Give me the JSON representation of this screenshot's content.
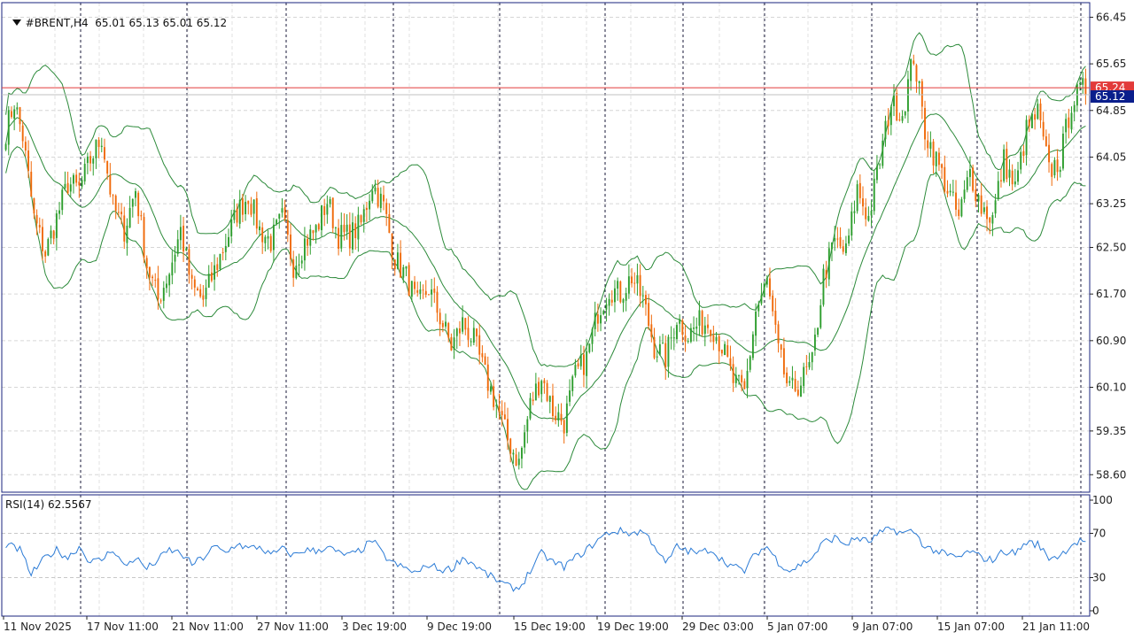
{
  "header": {
    "symbol_timeframe": "#BRENT,H4",
    "ohlc": "65.01 65.13 65.01 65.12",
    "menu_icon": "triangle-down-icon"
  },
  "price_panel": {
    "price_ticks": [
      "66.45",
      "65.65",
      "64.85",
      "64.05",
      "63.25",
      "62.50",
      "61.70",
      "60.90",
      "60.10",
      "59.35",
      "58.60"
    ],
    "bid_line_label": "65.24",
    "last_price_label": "65.12",
    "colors": {
      "bull": "#2e9e2e",
      "bear": "#f06a0a",
      "bands": "#2c8a3a",
      "bid_line": "#e23a3a",
      "last_price_bg": "#0a1e8c"
    }
  },
  "rsi_panel": {
    "label": "RSI(14) 62.5567",
    "ticks": [
      "100",
      "70",
      "30",
      "0"
    ],
    "color": "#2b7bd6"
  },
  "time_labels": [
    "11 Nov 2025",
    "17 Nov 11:00",
    "21 Nov 11:00",
    "27 Nov 11:00",
    "3 Dec 19:00",
    "9 Dec 19:00",
    "15 Dec 19:00",
    "19 Dec 19:00",
    "29 Dec 03:00",
    "5 Jan 07:00",
    "9 Jan 07:00",
    "15 Jan 07:00",
    "21 Jan 11:00"
  ],
  "chart_data": {
    "type": "candlestick",
    "symbol": "#BRENT",
    "timeframe": "H4",
    "y_range": [
      58.3,
      66.7
    ],
    "rsi_range": [
      0,
      100
    ],
    "rsi_levels": [
      70,
      30
    ],
    "anchors": [
      [
        0,
        64.5
      ],
      [
        3,
        65.0
      ],
      [
        6,
        64.4
      ],
      [
        10,
        63.0
      ],
      [
        14,
        62.4
      ],
      [
        18,
        63.0
      ],
      [
        22,
        63.6
      ],
      [
        26,
        63.5
      ],
      [
        30,
        64.0
      ],
      [
        34,
        64.4
      ],
      [
        38,
        63.2
      ],
      [
        42,
        62.8
      ],
      [
        46,
        63.5
      ],
      [
        50,
        62.2
      ],
      [
        54,
        61.6
      ],
      [
        58,
        62.1
      ],
      [
        62,
        62.8
      ],
      [
        66,
        61.8
      ],
      [
        70,
        61.6
      ],
      [
        74,
        62.1
      ],
      [
        78,
        62.6
      ],
      [
        82,
        63.1
      ],
      [
        86,
        63.4
      ],
      [
        90,
        62.8
      ],
      [
        94,
        62.6
      ],
      [
        98,
        63.0
      ],
      [
        102,
        62.2
      ],
      [
        106,
        62.6
      ],
      [
        110,
        62.8
      ],
      [
        114,
        63.3
      ],
      [
        118,
        62.7
      ],
      [
        122,
        62.7
      ],
      [
        126,
        62.9
      ],
      [
        130,
        63.6
      ],
      [
        134,
        63.2
      ],
      [
        138,
        62.3
      ],
      [
        142,
        62.0
      ],
      [
        146,
        61.5
      ],
      [
        150,
        61.8
      ],
      [
        154,
        61.3
      ],
      [
        158,
        60.8
      ],
      [
        162,
        61.2
      ],
      [
        166,
        60.9
      ],
      [
        170,
        60.3
      ],
      [
        174,
        59.8
      ],
      [
        178,
        59.2
      ],
      [
        182,
        58.8
      ],
      [
        186,
        59.8
      ],
      [
        190,
        60.3
      ],
      [
        194,
        59.7
      ],
      [
        198,
        59.5
      ],
      [
        202,
        60.3
      ],
      [
        206,
        60.6
      ],
      [
        210,
        61.4
      ],
      [
        214,
        61.8
      ],
      [
        218,
        61.7
      ],
      [
        222,
        62.0
      ],
      [
        226,
        61.6
      ],
      [
        230,
        60.8
      ],
      [
        234,
        60.6
      ],
      [
        238,
        61.3
      ],
      [
        242,
        61.0
      ],
      [
        246,
        61.2
      ],
      [
        250,
        61.2
      ],
      [
        254,
        60.8
      ],
      [
        258,
        60.2
      ],
      [
        262,
        60.0
      ],
      [
        266,
        61.4
      ],
      [
        270,
        61.9
      ],
      [
        274,
        60.7
      ],
      [
        278,
        60.0
      ],
      [
        282,
        60.2
      ],
      [
        286,
        60.5
      ],
      [
        290,
        62.0
      ],
      [
        294,
        62.6
      ],
      [
        298,
        62.4
      ],
      [
        302,
        63.5
      ],
      [
        306,
        63.0
      ],
      [
        310,
        64.0
      ],
      [
        314,
        65.0
      ],
      [
        318,
        64.8
      ],
      [
        322,
        65.8
      ],
      [
        326,
        64.5
      ],
      [
        330,
        64.0
      ],
      [
        334,
        63.5
      ],
      [
        338,
        63.0
      ],
      [
        342,
        63.8
      ],
      [
        346,
        63.2
      ],
      [
        350,
        63.0
      ],
      [
        354,
        64.0
      ],
      [
        358,
        63.5
      ],
      [
        362,
        64.5
      ],
      [
        366,
        64.8
      ],
      [
        370,
        63.8
      ],
      [
        374,
        64.0
      ],
      [
        378,
        65.0
      ],
      [
        382,
        65.2
      ],
      [
        383,
        65.12
      ]
    ],
    "rsi_anchors": [
      [
        0,
        60
      ],
      [
        5,
        55
      ],
      [
        9,
        33
      ],
      [
        14,
        48
      ],
      [
        18,
        55
      ],
      [
        22,
        48
      ],
      [
        26,
        58
      ],
      [
        30,
        44
      ],
      [
        34,
        46
      ],
      [
        38,
        56
      ],
      [
        42,
        40
      ],
      [
        46,
        48
      ],
      [
        50,
        38
      ],
      [
        54,
        46
      ],
      [
        58,
        55
      ],
      [
        62,
        52
      ],
      [
        66,
        42
      ],
      [
        70,
        48
      ],
      [
        74,
        58
      ],
      [
        78,
        52
      ],
      [
        82,
        61
      ],
      [
        86,
        56
      ],
      [
        90,
        58
      ],
      [
        94,
        50
      ],
      [
        98,
        56
      ],
      [
        102,
        50
      ],
      [
        106,
        55
      ],
      [
        110,
        54
      ],
      [
        114,
        58
      ],
      [
        118,
        52
      ],
      [
        122,
        50
      ],
      [
        126,
        55
      ],
      [
        130,
        64
      ],
      [
        134,
        50
      ],
      [
        138,
        42
      ],
      [
        142,
        38
      ],
      [
        146,
        34
      ],
      [
        150,
        42
      ],
      [
        154,
        37
      ],
      [
        158,
        38
      ],
      [
        162,
        48
      ],
      [
        166,
        42
      ],
      [
        170,
        34
      ],
      [
        174,
        28
      ],
      [
        178,
        22
      ],
      [
        182,
        20
      ],
      [
        186,
        36
      ],
      [
        190,
        52
      ],
      [
        194,
        44
      ],
      [
        198,
        40
      ],
      [
        202,
        48
      ],
      [
        206,
        55
      ],
      [
        210,
        64
      ],
      [
        214,
        71
      ],
      [
        218,
        72
      ],
      [
        222,
        70
      ],
      [
        226,
        72
      ],
      [
        230,
        60
      ],
      [
        234,
        42
      ],
      [
        238,
        58
      ],
      [
        242,
        54
      ],
      [
        246,
        52
      ],
      [
        250,
        56
      ],
      [
        254,
        46
      ],
      [
        258,
        40
      ],
      [
        262,
        36
      ],
      [
        266,
        52
      ],
      [
        270,
        58
      ],
      [
        274,
        44
      ],
      [
        278,
        36
      ],
      [
        282,
        42
      ],
      [
        286,
        48
      ],
      [
        290,
        62
      ],
      [
        294,
        66
      ],
      [
        298,
        60
      ],
      [
        302,
        66
      ],
      [
        306,
        62
      ],
      [
        310,
        70
      ],
      [
        314,
        74
      ],
      [
        318,
        70
      ],
      [
        322,
        72
      ],
      [
        326,
        58
      ],
      [
        330,
        54
      ],
      [
        334,
        50
      ],
      [
        338,
        48
      ],
      [
        342,
        54
      ],
      [
        346,
        48
      ],
      [
        350,
        46
      ],
      [
        354,
        54
      ],
      [
        358,
        52
      ],
      [
        362,
        62
      ],
      [
        366,
        60
      ],
      [
        370,
        48
      ],
      [
        374,
        50
      ],
      [
        378,
        60
      ],
      [
        382,
        64
      ],
      [
        383,
        62.6
      ]
    ],
    "bar_count": 384,
    "separator_bars": [
      30,
      70,
      107,
      147,
      187,
      227,
      257,
      287,
      327,
      367,
      407
    ],
    "grid": true
  }
}
